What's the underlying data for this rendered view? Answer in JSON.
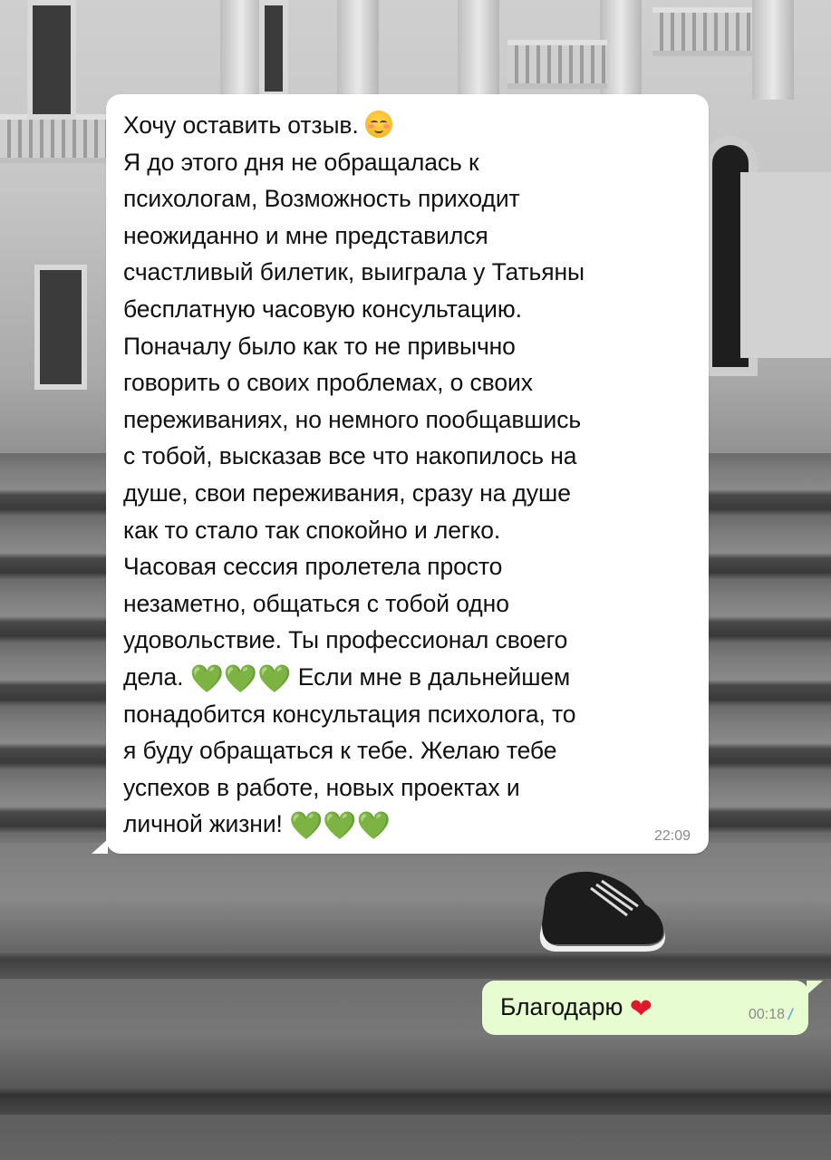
{
  "chat": {
    "incoming": {
      "text_lines": [
        "Хочу оставить отзыв.",
        "Я до этого дня не обращалась к",
        "психологам, Возможность приходит",
        "неожиданно и мне представился",
        "счастливый билетик, выиграла у Татьяны",
        "бесплатную часовую консультацию.",
        "Поначалу было как то не привычно",
        "говорить о своих проблемах, о своих",
        "переживаниях, но немного пообщавшись",
        "с тобой, высказав все что накопилось на",
        "душе, свои переживания, сразу на душе",
        "как то стало так спокойно и легко.",
        "Часовая сессия пролетела просто",
        "незаметно, общаться с тобой одно",
        "удовольствие. Ты профессионал своего",
        "дела.",
        "Если мне в дальнейшем",
        "понадобится консультация психолога, то",
        "я буду обращаться к тебе. Желаю тебе",
        "успехов в работе, новых проектах и",
        "личной жизни!"
      ],
      "time": "22:09",
      "emoji": {
        "blush": "blush-emoji",
        "heart": "💚"
      }
    },
    "outgoing": {
      "text": "Благодарю",
      "heart": "❤",
      "time": "00:18",
      "status": "read-double-check"
    }
  },
  "colors": {
    "incoming_bubble": "#ffffff",
    "outgoing_bubble": "#e7fdd1",
    "green_heart": "#3cc23c",
    "red_heart": "#e0192a",
    "read_ticks": "#5aa7e6"
  }
}
